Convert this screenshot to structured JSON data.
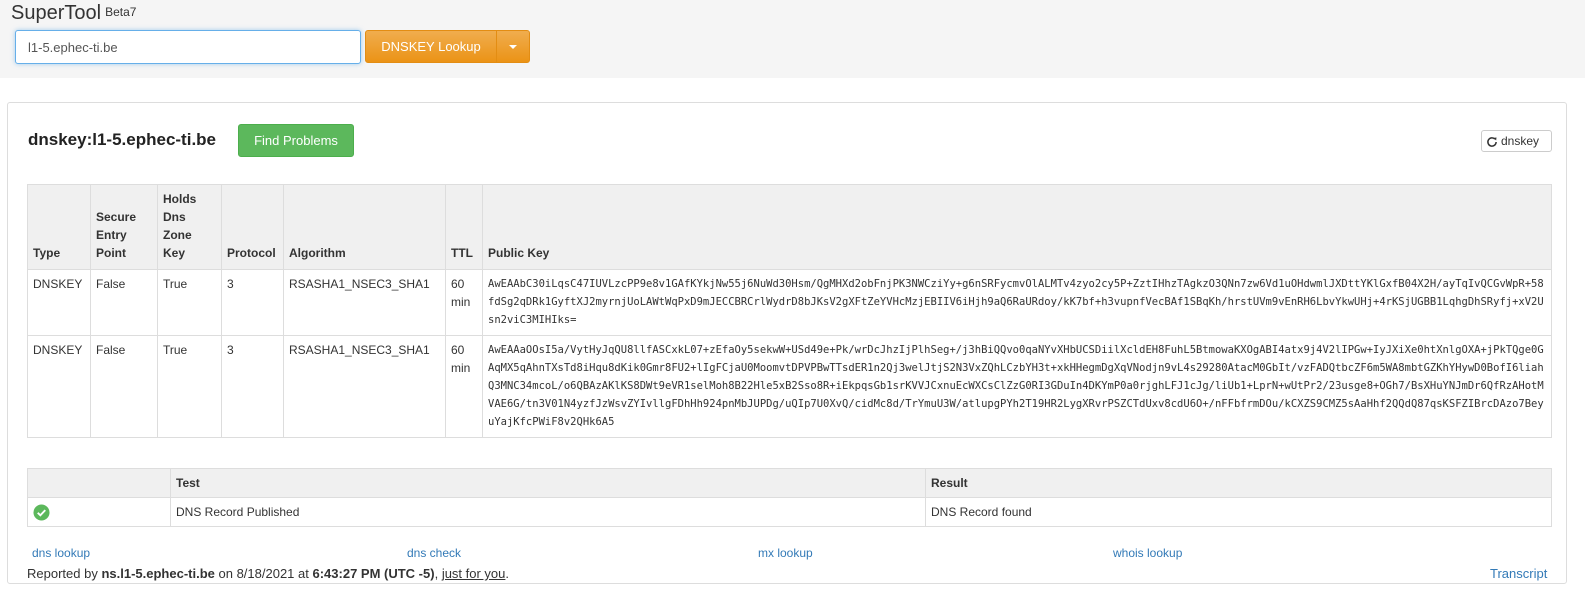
{
  "app": {
    "name": "SuperTool",
    "version": "Beta7"
  },
  "search": {
    "value": "l1-5.ephec-ti.be"
  },
  "lookup_button": {
    "label": "DNSKEY Lookup"
  },
  "page_title": "dnskey:l1-5.ephec-ti.be",
  "find_problems_label": "Find Problems",
  "refresh_label": "dnskey",
  "keys_table": {
    "headers": {
      "type": "Type",
      "sep": "Secure Entry Point",
      "zone": "Holds Dns Zone Key",
      "protocol": "Protocol",
      "algorithm": "Algorithm",
      "ttl": "TTL",
      "public_key": "Public Key"
    },
    "rows": [
      {
        "type": "DNSKEY",
        "sep": "False",
        "zone": "True",
        "protocol": "3",
        "algorithm": "RSASHA1_NSEC3_SHA1",
        "ttl": "60 min",
        "public_key": "AwEAAbC30iLqsC47IUVLzcPP9e8v1GAfKYkjNw55j6NuWd30Hsm/QgMHXd2obFnjPK3NWCziYy+g6nSRFycmvOlALMTv4zyo2cy5P+ZztIHhzTAgkzO3QNn7zw6Vd1uOHdwmlJXDttYKlGxfB04X2H/ayTqIvQCGvWpR+58fdSg2qDRk1GyftXJ2myrnjUoLAWtWqPxD9mJECCBRCrlWydrD8bJKsV2gXFtZeYVHcMzjEBIIV6iHjh9aQ6RaURdoy/kK7bf+h3vupnfVecBAf1SBqKh/hrstUVm9vEnRH6LbvYkwUHj+4rKSjUGBB1LqhgDhSRyfj+xV2Usn2viC3MIHIks="
      },
      {
        "type": "DNSKEY",
        "sep": "False",
        "zone": "True",
        "protocol": "3",
        "algorithm": "RSASHA1_NSEC3_SHA1",
        "ttl": "60 min",
        "public_key": "AwEAAaOOsI5a/VytHyJqQU8llfASCxkL07+zEfaOy5sekwW+USd49e+Pk/wrDcJhzIjPlhSeg+/j3hBiQQvo0qaNYvXHbUCSDiilXcldEH8FuhL5BtmowaKXOgABI4atx9j4V2lIPGw+IyJXiXe0htXnlgOXA+jPkTQge0GAqMX5qAhnTXsTd8iHqu8dKik0Gmr8FU2+lIgFCjaU0MoomvtDPVPBwTTsdER1n2Qj3welJtjS2N3VxZQhLCzbYH3t+xkHHegmDgXqVNodjn9vL4s29280AtacM0GbIt/vzFADQtbcZF6m5WA8mbtGZKhYHywD0BofI6liahQ3MNC34mcoL/o6QBAzAKlKS8DWt9eVR1selMoh8B22Hle5xB2Sso8R+iEkpqsGb1srKVVJCxnuEcWXCsClZzG0RI3GDuIn4DKYmP0a0rjghLFJ1cJg/liUb1+LprN+wUtPr2/23usge8+OGh7/BsXHuYNJmDr6QfRzAHotMVAE6G/tn3V01N4yzfJzWsvZYIvllgFDhHh924pnMbJUPDg/uQIp7U0XvQ/cidMc8d/TrYmuU3W/atlupgPYh2T19HR2LygXRvrPSZCTdUxv8cdU6O+/nFFbfrmDOu/kCXZS9CMZ5sAaHhf2QQdQ87qsKSFZIBrcDAzo7BeyuYajKfcPWiF8v2QHk6A5"
      }
    ]
  },
  "tests_table": {
    "headers": {
      "status": "",
      "test": "Test",
      "result": "Result"
    },
    "rows": [
      {
        "status_icon": "check-circle-icon",
        "test": "DNS Record Published",
        "result": "DNS Record found"
      }
    ]
  },
  "footer_links": {
    "dns_lookup": "dns lookup",
    "dns_check": "dns check",
    "mx_lookup": "mx lookup",
    "whois_lookup": "whois lookup"
  },
  "reported": {
    "prefix": "Reported by",
    "server": "ns.l1-5.ephec-ti.be",
    "on": "on 8/18/2021 at",
    "time": "6:43:27 PM (UTC -5)",
    "comma": ",",
    "link": "just for you",
    "end": "."
  },
  "transcript_label": "Transcript",
  "colors": {
    "lookup_orange": "#f0ad4e",
    "find_green": "#5cb85c",
    "ok_green": "#5cb85c",
    "link_blue": "#337ab7"
  }
}
